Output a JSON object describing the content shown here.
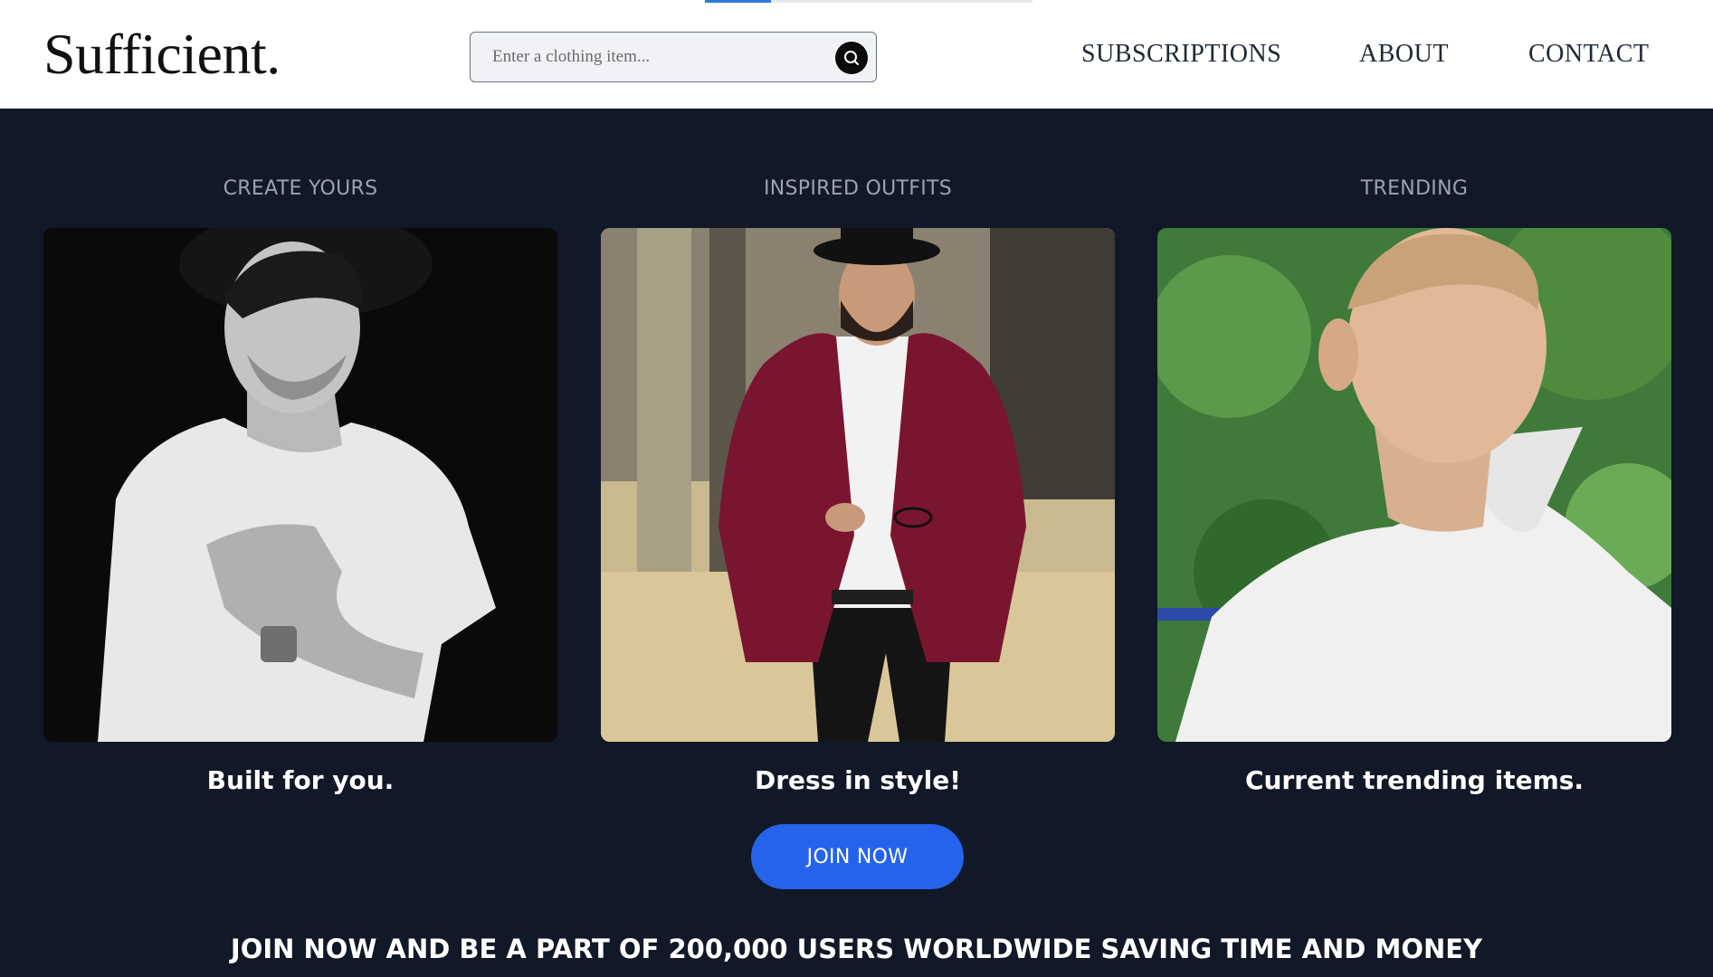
{
  "brand": {
    "logo": "Sufficient."
  },
  "search": {
    "placeholder": "Enter a clothing item...",
    "icon": "search-icon"
  },
  "nav": {
    "items": [
      {
        "label": "SUBSCRIPTIONS"
      },
      {
        "label": "ABOUT"
      },
      {
        "label": "CONTACT"
      }
    ]
  },
  "cards": [
    {
      "heading": "CREATE YOURS",
      "caption": "Built for you.",
      "image": "man in white t-shirt and black hat, black and white photo"
    },
    {
      "heading": "INSPIRED OUTFITS",
      "caption": "Dress in style!",
      "image": "bearded man in burgundy velvet blazer and bowler hat holding glasses"
    },
    {
      "heading": "TRENDING",
      "caption": "Current trending items.",
      "image": "man in white polo shirt with green trees behind"
    }
  ],
  "cta": {
    "join_label": "JOIN NOW"
  },
  "promo": {
    "text": "JOIN NOW AND BE A PART OF 200,000 USERS WORLDWIDE SAVING TIME AND MONEY"
  },
  "colors": {
    "background": "#111827",
    "header": "#ffffff",
    "accent": "#2563eb",
    "heading_text": "#9ca3af"
  }
}
